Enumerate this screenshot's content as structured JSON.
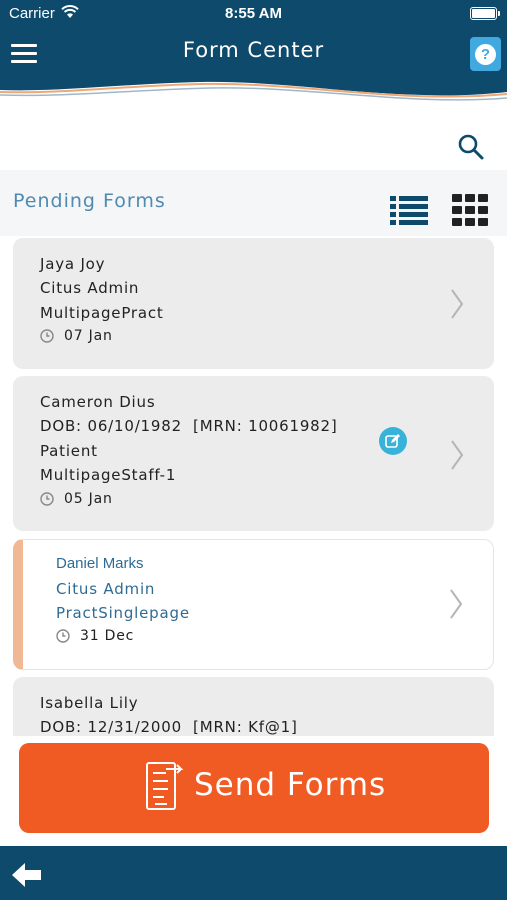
{
  "status_bar": {
    "carrier": "Carrier",
    "time": "8:55 AM"
  },
  "nav": {
    "title": "Form Center",
    "menu_icon": "hamburger-menu-icon",
    "help_icon": "question-mark-icon"
  },
  "search": {
    "icon": "search-icon"
  },
  "section": {
    "title": "Pending Forms",
    "list_view_icon": "list-view-icon",
    "grid_view_icon": "grid-view-icon"
  },
  "forms": [
    {
      "name": "Jaya Joy",
      "role": "Citus Admin",
      "form": "MultipagePract",
      "date": "07 Jan"
    },
    {
      "name": "Cameron Dius",
      "dob": "DOB: 06/10/1982  [MRN: 10061982]",
      "role": "Patient",
      "form": "MultipageStaff-1",
      "date": "05 Jan",
      "has_edit": true
    },
    {
      "name": "Daniel Marks",
      "role": "Citus Admin",
      "form": "PractSinglepage",
      "date": "31 Dec",
      "selected": true
    },
    {
      "name": "Isabella Lily",
      "dob": "DOB: 12/31/2000  [MRN: Kf@1]"
    }
  ],
  "send_button": {
    "label": "Send Forms",
    "icon": "send-document-icon"
  },
  "bottom_bar": {
    "back_icon": "back-arrow-icon"
  },
  "colors": {
    "primary": "#0d4a6b",
    "accent": "#f05a23",
    "help": "#41a9e0",
    "section_title": "#4f8ab0",
    "selected_border": "#f0b894",
    "edit_badge": "#38b2d8"
  }
}
